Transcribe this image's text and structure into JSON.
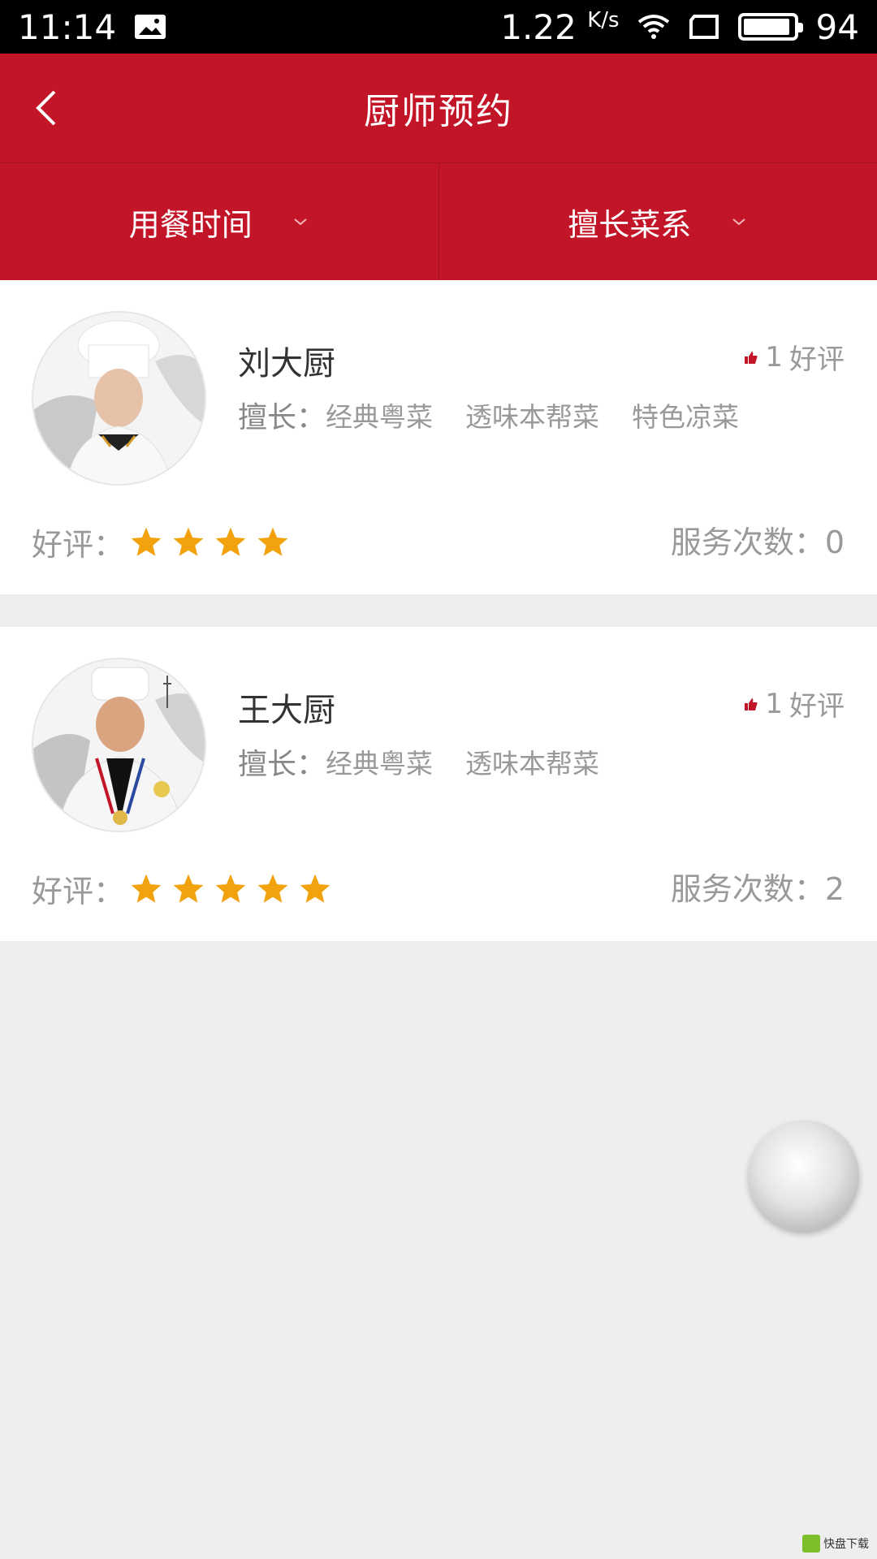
{
  "status_bar": {
    "time": "11:14",
    "net_speed": "1.22",
    "net_unit": "K/s",
    "battery": "94",
    "battery_level": 0.94
  },
  "header": {
    "title": "厨师预约"
  },
  "filters": [
    {
      "label": "用餐时间"
    },
    {
      "label": "擅长菜系"
    }
  ],
  "chefs": [
    {
      "name": "刘大厨",
      "praise_count": "1",
      "praise_label": "好评",
      "specialty_label": "擅长：",
      "specialties": [
        "经典粤菜",
        "透味本帮菜",
        "特色凉菜"
      ],
      "rating_label": "好评：",
      "stars": 4,
      "service_text": "服务次数：0"
    },
    {
      "name": "王大厨",
      "praise_count": "1",
      "praise_label": "好评",
      "specialty_label": "擅长：",
      "specialties": [
        "经典粤菜",
        "透味本帮菜"
      ],
      "rating_label": "好评：",
      "stars": 5,
      "service_text": "服务次数：2"
    }
  ],
  "colors": {
    "primary": "#c31528",
    "star": "#f2a20c",
    "background": "#eeeeee"
  },
  "watermark": {
    "text": "快盘下载"
  }
}
